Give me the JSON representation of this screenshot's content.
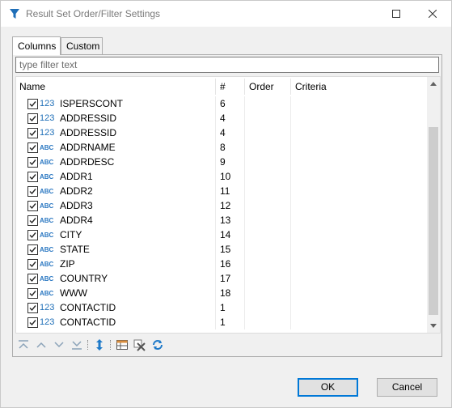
{
  "window": {
    "title": "Result Set Order/Filter Settings",
    "accent": "#0078d7"
  },
  "tabs": [
    {
      "label": "Columns",
      "active": true
    },
    {
      "label": "Custom",
      "active": false
    }
  ],
  "filter": {
    "value": "",
    "placeholder": "type filter text"
  },
  "table": {
    "headers": {
      "name": "Name",
      "number": "#",
      "order": "Order",
      "criteria": "Criteria"
    },
    "rows": [
      {
        "checked": true,
        "type_icon": "123",
        "type": "numeric",
        "name": "ISPERSCONT",
        "num": "6"
      },
      {
        "checked": true,
        "type_icon": "123",
        "type": "numeric",
        "name": "ADDRESSID",
        "num": "4"
      },
      {
        "checked": true,
        "type_icon": "123",
        "type": "numeric",
        "name": "ADDRESSID",
        "num": "4"
      },
      {
        "checked": true,
        "type_icon": "ABC",
        "type": "text",
        "name": "ADDRNAME",
        "num": "8"
      },
      {
        "checked": true,
        "type_icon": "ABC",
        "type": "text",
        "name": "ADDRDESC",
        "num": "9"
      },
      {
        "checked": true,
        "type_icon": "ABC",
        "type": "text",
        "name": "ADDR1",
        "num": "10"
      },
      {
        "checked": true,
        "type_icon": "ABC",
        "type": "text",
        "name": "ADDR2",
        "num": "11"
      },
      {
        "checked": true,
        "type_icon": "ABC",
        "type": "text",
        "name": "ADDR3",
        "num": "12"
      },
      {
        "checked": true,
        "type_icon": "ABC",
        "type": "text",
        "name": "ADDR4",
        "num": "13"
      },
      {
        "checked": true,
        "type_icon": "ABC",
        "type": "text",
        "name": "CITY",
        "num": "14"
      },
      {
        "checked": true,
        "type_icon": "ABC",
        "type": "text",
        "name": "STATE",
        "num": "15"
      },
      {
        "checked": true,
        "type_icon": "ABC",
        "type": "text",
        "name": "ZIP",
        "num": "16"
      },
      {
        "checked": true,
        "type_icon": "ABC",
        "type": "text",
        "name": "COUNTRY",
        "num": "17"
      },
      {
        "checked": true,
        "type_icon": "ABC",
        "type": "text",
        "name": "WWW",
        "num": "18"
      },
      {
        "checked": true,
        "type_icon": "123",
        "type": "numeric",
        "name": "CONTACTID",
        "num": "1"
      },
      {
        "checked": true,
        "type_icon": "123",
        "type": "numeric",
        "name": "CONTACTID",
        "num": "1"
      }
    ]
  },
  "toolbar": {
    "icons": [
      "move-top-icon",
      "move-up-icon",
      "move-down-icon",
      "move-bottom-icon",
      "sort-icon",
      "table-icon",
      "delete-icon",
      "refresh-icon"
    ]
  },
  "buttons": {
    "ok": "OK",
    "cancel": "Cancel"
  }
}
